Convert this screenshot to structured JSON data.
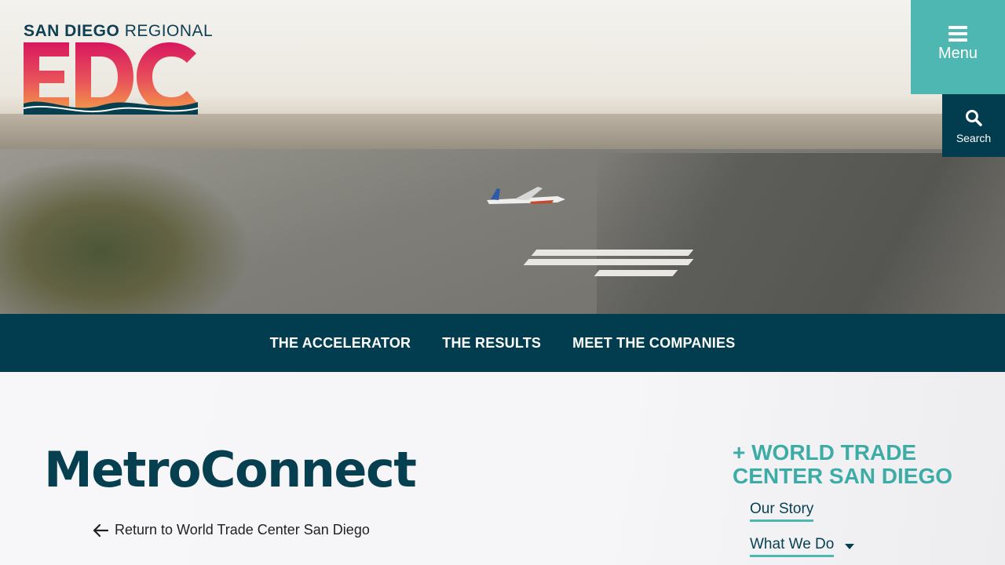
{
  "logo": {
    "top_bold": "SAN DIEGO",
    "top_regular": "REGIONAL",
    "letters": "EDC"
  },
  "header": {
    "menu_label": "Menu",
    "search_label": "Search"
  },
  "subnav": {
    "items": [
      {
        "label": "THE ACCELERATOR"
      },
      {
        "label": "THE RESULTS"
      },
      {
        "label": "MEET THE COMPANIES"
      }
    ]
  },
  "main": {
    "title": "MetroConnect",
    "return_link": "Return to World Trade Center San Diego"
  },
  "sidebar": {
    "heading": "+ WORLD TRADE CENTER SAN DIEGO",
    "items": [
      {
        "label": "Our Story",
        "has_dropdown": false
      },
      {
        "label": "What We Do",
        "has_dropdown": true
      }
    ]
  },
  "colors": {
    "navy": "#023d4f",
    "teal": "#4fb7b1",
    "pink": "#d8175f",
    "orange": "#f0834a"
  }
}
